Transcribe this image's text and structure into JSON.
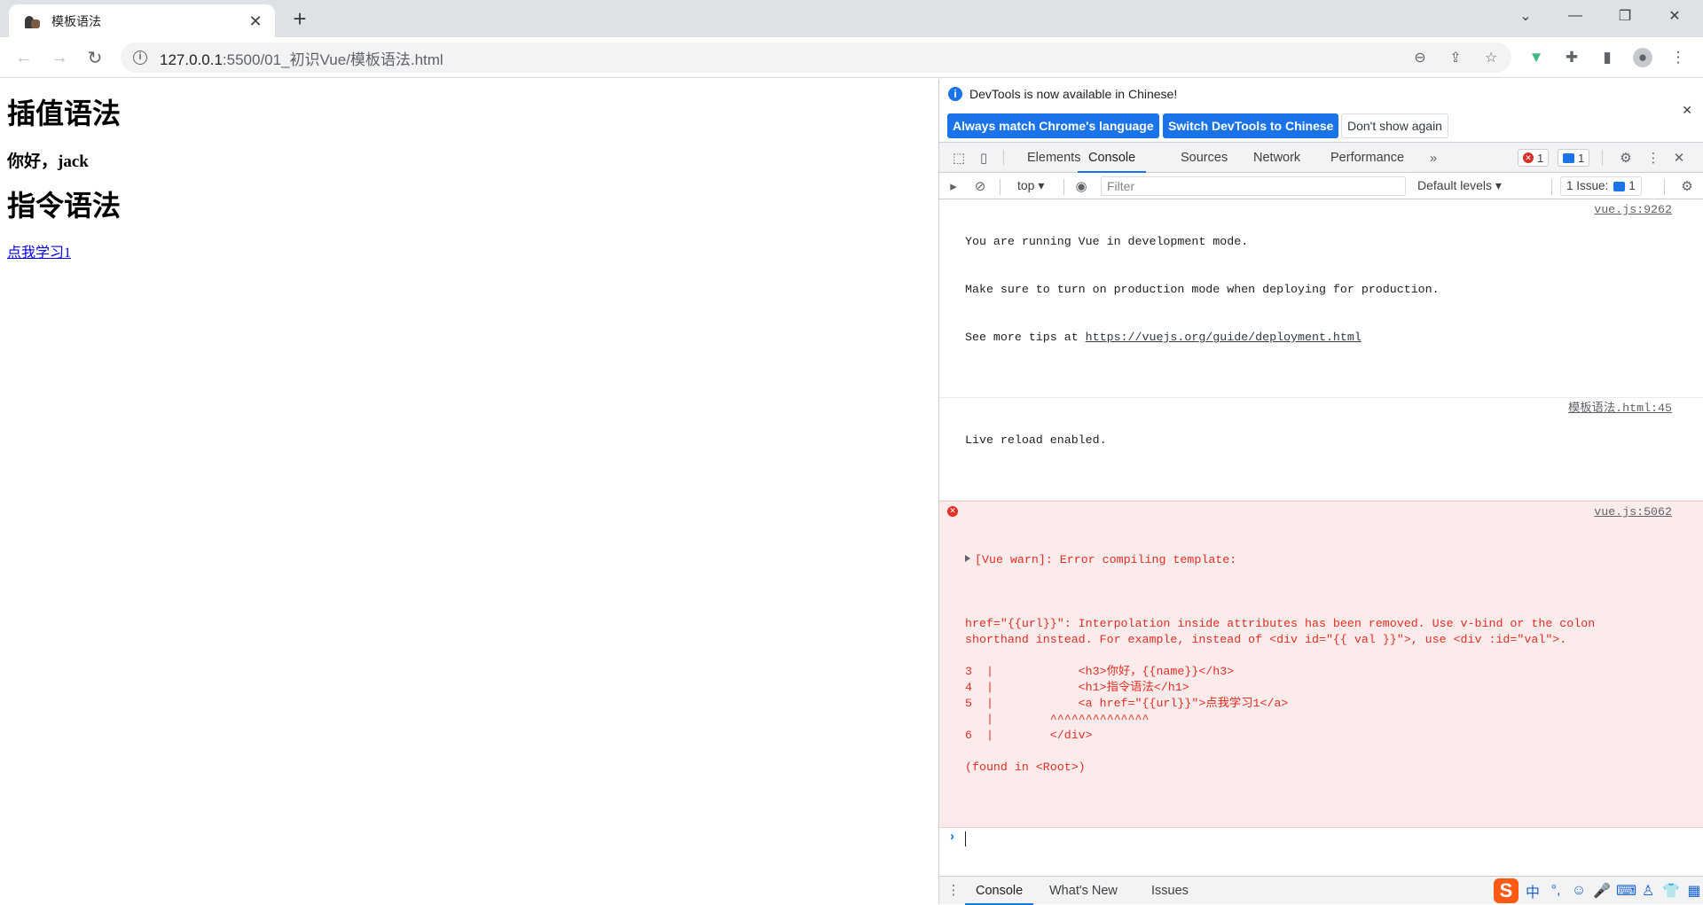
{
  "browser": {
    "tab": {
      "title": "模板语法"
    },
    "url": {
      "host": "127.0.0.1",
      "path": ":5500/01_初识Vue/模板语法.html"
    }
  },
  "page": {
    "h1_interpolation": "插值语法",
    "greeting": "你好，jack",
    "h1_directive": "指令语法",
    "link_text": "点我学习1"
  },
  "devtools": {
    "infobar": {
      "message": "DevTools is now available in Chinese!",
      "btn_match": "Always match Chrome's language",
      "btn_switch": "Switch DevTools to Chinese",
      "btn_dismiss": "Don't show again"
    },
    "tabs": [
      "Elements",
      "Console",
      "Sources",
      "Network",
      "Performance"
    ],
    "error_count": "1",
    "message_count": "1",
    "filterbar": {
      "context": "top",
      "filter_placeholder": "Filter",
      "levels": "Default levels",
      "issues_label": "1 Issue:",
      "issues_count": "1"
    },
    "console": {
      "msg1_line1": "You are running Vue in development mode.",
      "msg1_line2": "Make sure to turn on production mode when deploying for production.",
      "msg1_line3_prefix": "See more tips at ",
      "msg1_link": "https://vuejs.org/guide/deployment.html",
      "msg1_src": "vue.js:9262",
      "msg2_text": "Live reload enabled.",
      "msg2_src": "模板语法.html:45",
      "err_head": "[Vue warn]: Error compiling template:",
      "err_src": "vue.js:5062",
      "err_body": "\nhref=\"{{url}}\": Interpolation inside attributes has been removed. Use v-bind or the colon\nshorthand instead. For example, instead of <div id=\"{{ val }}\">, use <div :id=\"val\">.\n\n3  |            <h3>你好，{{name}}</h3>\n4  |            <h1>指令语法</h1>\n5  |            <a href=\"{{url}}\">点我学习1</a>\n   |        ^^^^^^^^^^^^^^\n6  |        </div>\n\n(found in <Root>)"
    },
    "drawer_tabs": [
      "Console",
      "What's New",
      "Issues"
    ],
    "ime": {
      "logo": "S",
      "mode": "中"
    }
  }
}
